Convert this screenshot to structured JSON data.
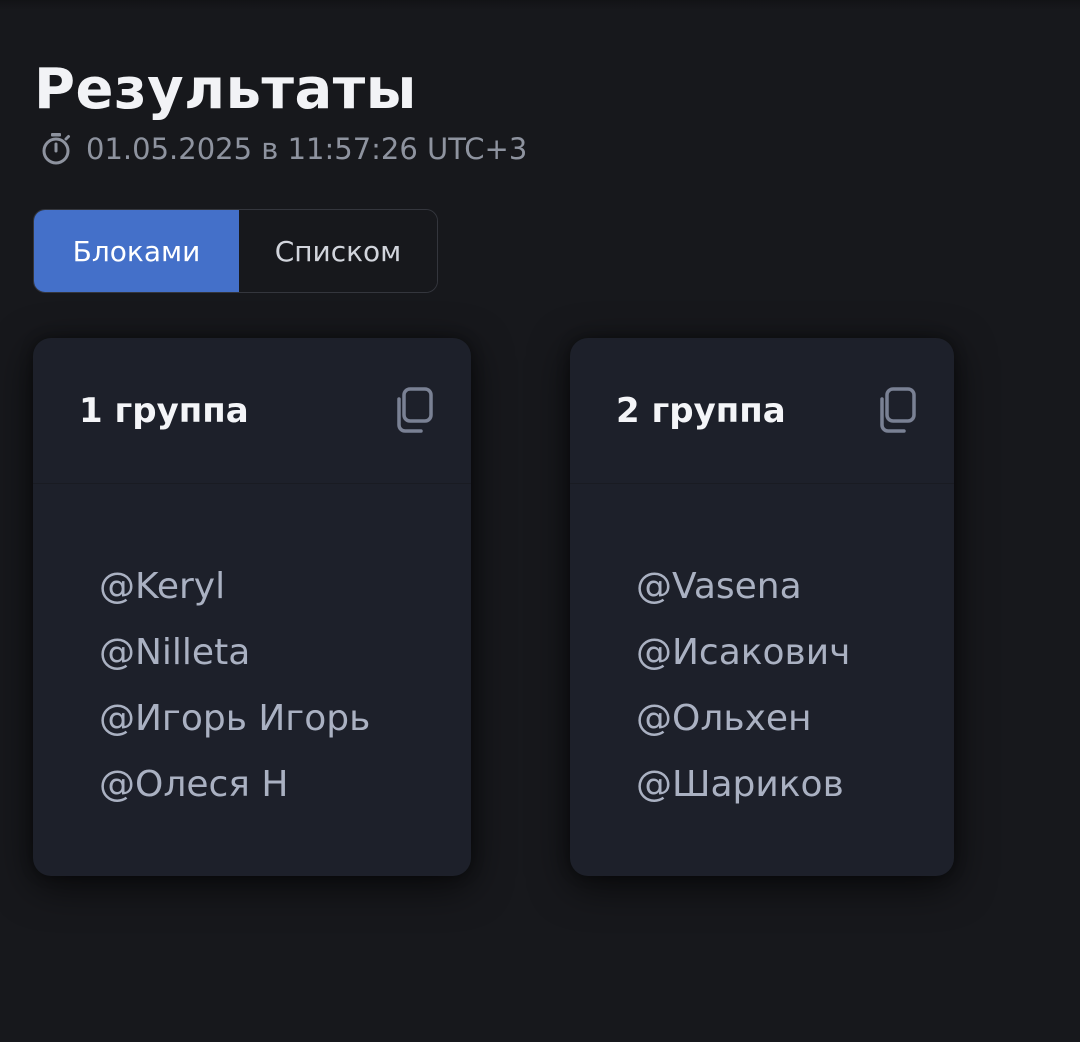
{
  "page": {
    "title": "Результаты",
    "timestamp": "01.05.2025 в 11:57:26 UTC+3",
    "timestamp_icon": "stopwatch-icon"
  },
  "view_toggle": {
    "blocks_label": "Блоками",
    "list_label": "Списком",
    "selected": "Блоками"
  },
  "groups": [
    {
      "title": "1 группа",
      "copy_icon": "copy-icon",
      "members": [
        "@Keryl",
        "@Nilleta",
        "@Игорь Игорь",
        "@Олеся Н"
      ]
    },
    {
      "title": "2 группа",
      "copy_icon": "copy-icon",
      "members": [
        "@Vasena",
        "@Исакович",
        "@Ольхен",
        "@Шариков"
      ]
    }
  ],
  "colors": {
    "background": "#17181c",
    "card": "#1d202a",
    "accent": "#4470c9",
    "muted_text": "#8e939f",
    "member_text": "#aab1c2"
  }
}
